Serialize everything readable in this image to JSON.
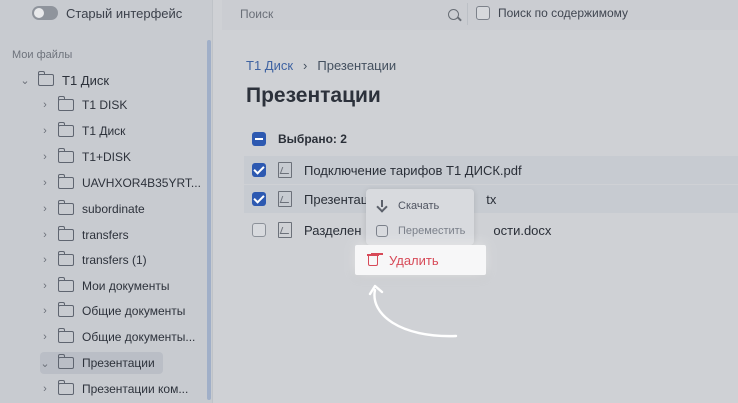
{
  "toggle": {
    "label": "Старый интерфейс"
  },
  "sidebar": {
    "section_title": "Мои файлы",
    "root_label": "Т1 Диск",
    "items": [
      {
        "label": "T1 DISK"
      },
      {
        "label": "T1 Диск"
      },
      {
        "label": "T1+DISK"
      },
      {
        "label": "UAVHXOR4B35YRT..."
      },
      {
        "label": "subordinate"
      },
      {
        "label": "transfers"
      },
      {
        "label": "transfers (1)"
      },
      {
        "label": "Мои документы"
      },
      {
        "label": "Общие документы"
      },
      {
        "label": "Общие документы..."
      },
      {
        "label": "Презентации"
      },
      {
        "label": "Презентации ком..."
      }
    ]
  },
  "search": {
    "placeholder": "Поиск"
  },
  "content_search_label": "Поиск по содержимому",
  "breadcrumb": {
    "root": "Т1 Диск",
    "current": "Презентации"
  },
  "page_title": "Презентации",
  "selection": {
    "label": "Выбрано: 2"
  },
  "files": [
    {
      "name": "Подключение тарифов Т1 ДИСК.pdf"
    },
    {
      "name": "Презентац"
    },
    {
      "name": "Разделен"
    }
  ],
  "files_suffixes": {
    "row2": "tx",
    "row3": "ости.docx"
  },
  "context_menu": {
    "download": "Скачать",
    "move": "Переместить",
    "delete": "Удалить"
  }
}
